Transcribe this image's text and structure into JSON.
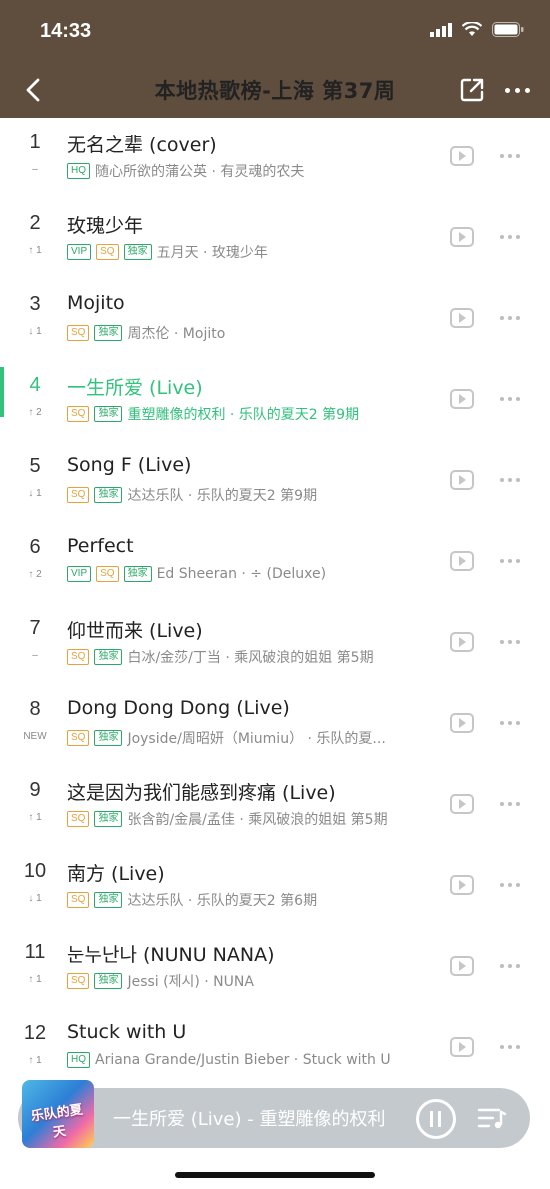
{
  "status": {
    "time": "14:33"
  },
  "nav": {
    "title": "本地热歌榜-上海 第37周"
  },
  "songs": [
    {
      "rank": "1",
      "change": "–",
      "title": "无名之辈 (cover)",
      "badges": [
        "HQ"
      ],
      "meta": "随心所欲的蒲公英 · 有灵魂的农夫"
    },
    {
      "rank": "2",
      "change": "↑ 1",
      "title": "玫瑰少年",
      "badges": [
        "VIP",
        "SQ",
        "独家"
      ],
      "meta": "五月天 · 玫瑰少年"
    },
    {
      "rank": "3",
      "change": "↓ 1",
      "title": "Mojito",
      "badges": [
        "SQ",
        "独家"
      ],
      "meta": "周杰伦 · Mojito"
    },
    {
      "rank": "4",
      "change": "↑ 2",
      "title": "一生所爱 (Live)",
      "badges": [
        "SQ",
        "独家"
      ],
      "meta": "重塑雕像的权利 · 乐队的夏天2 第9期",
      "active": true
    },
    {
      "rank": "5",
      "change": "↓ 1",
      "title": "Song F (Live)",
      "badges": [
        "SQ",
        "独家"
      ],
      "meta": "达达乐队 · 乐队的夏天2 第9期"
    },
    {
      "rank": "6",
      "change": "↑ 2",
      "title": "Perfect",
      "badges": [
        "VIP",
        "SQ",
        "独家"
      ],
      "meta": "Ed Sheeran · ÷ (Deluxe)"
    },
    {
      "rank": "7",
      "change": "–",
      "title": "仰世而来 (Live)",
      "badges": [
        "SQ",
        "独家"
      ],
      "meta": "白冰/金莎/丁当 · 乘风破浪的姐姐 第5期"
    },
    {
      "rank": "8",
      "change": "NEW",
      "title": "Dong Dong Dong (Live)",
      "badges": [
        "SQ",
        "独家"
      ],
      "meta": "Joyside/周昭妍（Miumiu） · 乐队的夏..."
    },
    {
      "rank": "9",
      "change": "↑ 1",
      "title": "这是因为我们能感到疼痛 (Live)",
      "badges": [
        "SQ",
        "独家"
      ],
      "meta": "张含韵/金晨/孟佳 · 乘风破浪的姐姐 第5期"
    },
    {
      "rank": "10",
      "change": "↓ 1",
      "title": "南方 (Live)",
      "badges": [
        "SQ",
        "独家"
      ],
      "meta": "达达乐队 · 乐队的夏天2 第6期"
    },
    {
      "rank": "11",
      "change": "↑ 1",
      "title": "눈누난나 (NUNU NANA)",
      "badges": [
        "SQ",
        "独家"
      ],
      "meta": "Jessi (제시) · NUNA"
    },
    {
      "rank": "12",
      "change": "↑ 1",
      "title": "Stuck with U",
      "badges": [
        "HQ"
      ],
      "meta": "Ariana Grande/Justin Bieber · Stuck with U"
    }
  ],
  "player": {
    "now_playing": "一生所爱 (Live) - 重塑雕像的权利",
    "cover_text": "乐队的夏天"
  },
  "colors": {
    "header": "#5f4e3d",
    "accent": "#31c27c",
    "sq": "#e6a23c"
  }
}
